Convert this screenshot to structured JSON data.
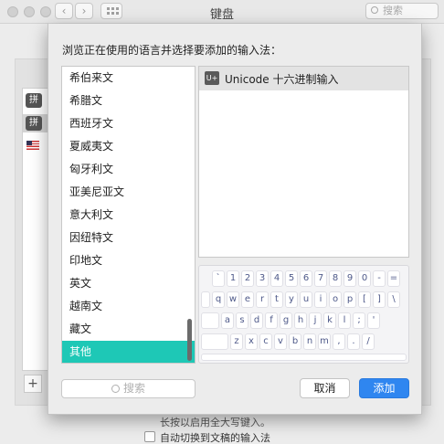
{
  "window": {
    "title": "键盘",
    "search_placeholder": "搜索",
    "nav_back": "‹",
    "nav_forward": "›"
  },
  "background": {
    "list_items": [
      "拼",
      "拼"
    ],
    "add_button": "+",
    "hint_text": "长按以启用全大写键入。",
    "auto_switch_label": "自动切换到文稿的输入法"
  },
  "dialog": {
    "prompt": "浏览正在使用的语言并选择要添加的输入法：",
    "languages": [
      "希伯来文",
      "希腊文",
      "西班牙文",
      "夏威夷文",
      "匈牙利文",
      "亚美尼亚文",
      "意大利文",
      "因纽特文",
      "印地文",
      "英文",
      "越南文",
      "藏文",
      "其他"
    ],
    "selected_language": "其他",
    "input_methods": [
      {
        "icon": "U+",
        "label": "Unicode 十六进制输入"
      }
    ],
    "keyboard_rows": [
      [
        "`",
        "1",
        "2",
        "3",
        "4",
        "5",
        "6",
        "7",
        "8",
        "9",
        "0",
        "-",
        "="
      ],
      [
        "q",
        "w",
        "e",
        "r",
        "t",
        "y",
        "u",
        "i",
        "o",
        "p",
        "[",
        "]",
        "\\"
      ],
      [
        "a",
        "s",
        "d",
        "f",
        "g",
        "h",
        "j",
        "k",
        "l",
        ";",
        "'"
      ],
      [
        "z",
        "x",
        "c",
        "v",
        "b",
        "n",
        "m",
        ",",
        ".",
        "/"
      ]
    ],
    "search_placeholder": "搜索",
    "cancel_label": "取消",
    "add_label": "添加"
  },
  "colors": {
    "selection": "#1ec8b6",
    "accent_button": "#2f86f0"
  }
}
